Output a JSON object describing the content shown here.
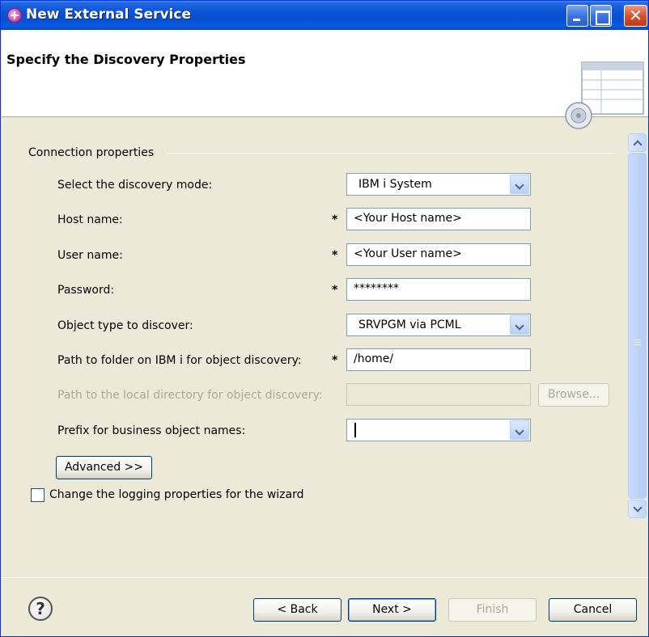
{
  "window": {
    "title": "New External Service"
  },
  "header": {
    "title": "Specify the Discovery Properties"
  },
  "group": {
    "title": "Connection properties"
  },
  "form": {
    "discovery_mode": {
      "label": "Select the discovery mode:",
      "value": "IBM i System"
    },
    "host_name": {
      "label": "Host name:",
      "value": "<Your Host name>",
      "required": "*"
    },
    "user_name": {
      "label": "User name:",
      "value": "<Your User name>",
      "required": "*"
    },
    "password": {
      "label": "Password:",
      "value": "********",
      "required": "*"
    },
    "object_type": {
      "label": "Object type to discover:",
      "value": "SRVPGM via PCML"
    },
    "ibmi_path": {
      "label": "Path to folder on IBM i for object discovery:",
      "value": "/home/",
      "required": "*"
    },
    "local_dir": {
      "label": "Path to the local directory for object discovery:",
      "value": "",
      "browse_label": "Browse..."
    },
    "prefix": {
      "label": "Prefix for business object names:",
      "value": ""
    },
    "advanced_label": "Advanced >>",
    "logging_checkbox_label": "Change the logging properties for the wizard"
  },
  "buttons": {
    "back": "< Back",
    "next": "Next >",
    "finish": "Finish",
    "cancel": "Cancel"
  },
  "icons": {
    "help": "?"
  }
}
